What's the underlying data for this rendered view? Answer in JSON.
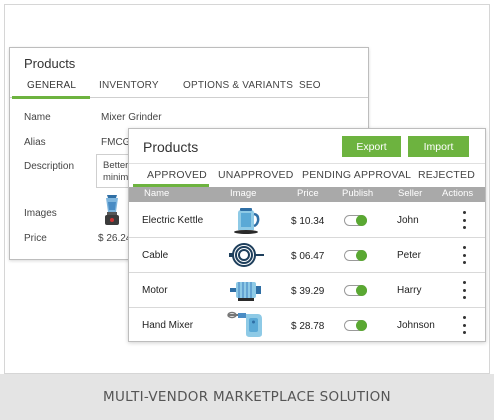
{
  "back_panel": {
    "title": "Products",
    "tabs": [
      "GENERAL",
      "INVENTORY",
      "OPTIONS & VARIANTS",
      "SEO"
    ],
    "fields": [
      {
        "label": "Name",
        "value": "Mixer Grinder"
      },
      {
        "label": "Alias",
        "value": "FMCG"
      },
      {
        "label": "Description",
        "value": "Better",
        "value2": "minim"
      },
      {
        "label": "Images",
        "value": ""
      },
      {
        "label": "Price",
        "value": "$ 26.24"
      }
    ]
  },
  "front_panel": {
    "title": "Products",
    "export_label": "Export",
    "import_label": "Import",
    "tabs": [
      "APPROVED",
      "UNAPPROVED",
      "PENDING APPROVAL",
      "REJECTED"
    ],
    "columns": [
      "Name",
      "Image",
      "Price",
      "Publish",
      "Seller",
      "Actions"
    ],
    "rows": [
      {
        "name": "Electric Kettle",
        "icon": "electric-kettle-icon",
        "price": "$ 10.34",
        "published": true,
        "seller": "John"
      },
      {
        "name": "Cable",
        "icon": "cable-icon",
        "price": "$ 06.47",
        "published": true,
        "seller": "Peter"
      },
      {
        "name": "Motor",
        "icon": "motor-icon",
        "price": "$ 39.29",
        "published": true,
        "seller": "Harry"
      },
      {
        "name": "Hand Mixer",
        "icon": "hand-mixer-icon",
        "price": "$ 28.78",
        "published": true,
        "seller": "Johnson"
      }
    ]
  },
  "footer": {
    "caption": "MULTI-VENDOR MARKETPLACE SOLUTION"
  },
  "colors": {
    "accent": "#6db33f",
    "header_bg": "#a9a9a9",
    "footer_bg": "#e4e4e4"
  }
}
